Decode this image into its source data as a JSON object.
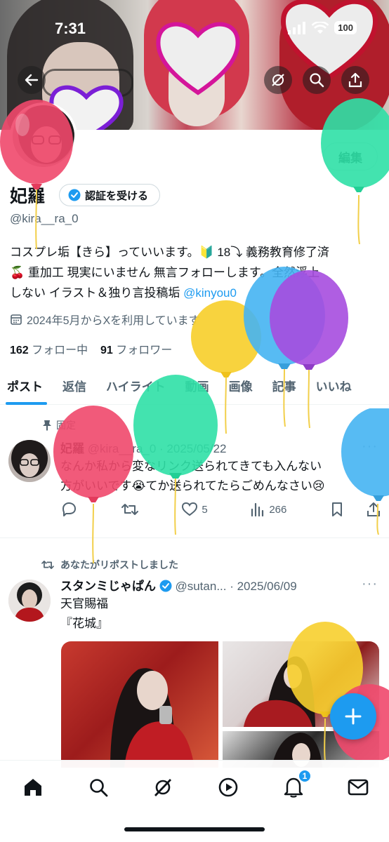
{
  "status_bar": {
    "time": "7:31",
    "battery": "100"
  },
  "header": {
    "back_icon": "arrow-left-icon",
    "grok_icon": "grok-icon",
    "search_icon": "search-icon",
    "share_icon": "share-icon"
  },
  "profile": {
    "name": "妃羅",
    "verify_button": "認証を受ける",
    "handle": "@kira__ra_0",
    "edit_button": "編集",
    "bio_line1": "コスプレ垢【きら】っていいます。🔰 18⤵ 義務教育修了済",
    "bio_line2": "🍒 重加工 現実にいません 無言フォローします。全然浮上",
    "bio_line3_prefix": "しない イラスト＆独り言投稿垢 ",
    "bio_link": "@kinyou0",
    "joined": "2024年5月からXを利用しています",
    "following_count": "162",
    "following_label": "フォロー中",
    "followers_count": "91",
    "followers_label": "フォロワー"
  },
  "tabs": [
    "ポスト",
    "返信",
    "ハイライト",
    "動画",
    "画像",
    "記事",
    "いいね"
  ],
  "pinned_post": {
    "pinned_label": "固定",
    "name": "妃羅",
    "handle_date": "@kira__ra_0 · 2025/05/22",
    "text_line1": "なんか私から変なリンク送られてきても入んない",
    "text_line2": "方がいいです😭てか送られてたらごめんなさい😢",
    "likes": "5",
    "views": "266"
  },
  "repost": {
    "repost_label": "あなたがリポストしました",
    "name": "スタンミじゃぱん",
    "handle_date": "@sutan... · 2025/06/09",
    "text_line1": "天官賜福",
    "text_line2": "『花城』"
  },
  "bottom_nav": {
    "items": [
      "home-icon",
      "search-icon",
      "grok-icon",
      "video-icon",
      "notifications-icon",
      "messages-icon"
    ],
    "notification_badge": "1"
  },
  "colors": {
    "accent": "#1d9bf0",
    "text_primary": "#0f1419",
    "text_secondary": "#536471",
    "balloon_red": "#f0486b",
    "balloon_green": "#2fe0a6",
    "balloon_yellow": "#f7cf2e",
    "balloon_blue": "#45b4f2",
    "balloon_purple": "#a64ddf"
  }
}
